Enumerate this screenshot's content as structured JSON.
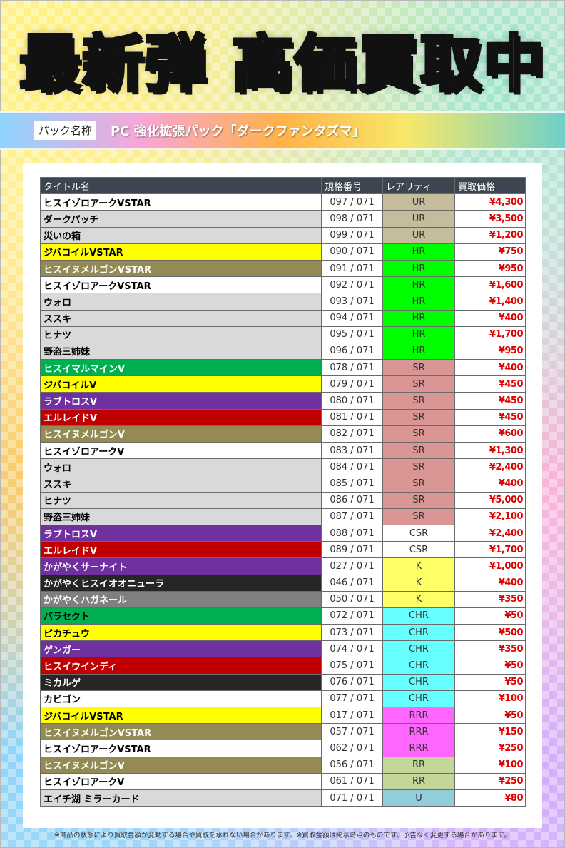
{
  "header": {
    "headline_left": "最新弾",
    "headline_right": "高価買取中"
  },
  "pack": {
    "label": "パック名称",
    "name": "PC 強化拡張パック「ダークファンタズマ」"
  },
  "table": {
    "columns": [
      "タイトル名",
      "規格番号",
      "レアリティ",
      "買取価格"
    ],
    "rows": [
      {
        "title": "ヒスイゾロアークVSTAR",
        "num": "097 / 071",
        "rarity": "UR",
        "price": "¥4,300",
        "bg": "#ffffff",
        "fg": "#000000",
        "rbg": "#c4bc9a"
      },
      {
        "title": "ダークパッチ",
        "num": "098 / 071",
        "rarity": "UR",
        "price": "¥3,500",
        "bg": "#d9d9d9",
        "fg": "#000000",
        "rbg": "#c4bc9a"
      },
      {
        "title": "災いの箱",
        "num": "099 / 071",
        "rarity": "UR",
        "price": "¥1,200",
        "bg": "#d9d9d9",
        "fg": "#000000",
        "rbg": "#c4bc9a"
      },
      {
        "title": "ジバコイルVSTAR",
        "num": "090 / 071",
        "rarity": "HR",
        "price": "¥750",
        "bg": "#ffff00",
        "fg": "#000000",
        "rbg": "#00ff00"
      },
      {
        "title": "ヒスイヌメルゴンVSTAR",
        "num": "091 / 071",
        "rarity": "HR",
        "price": "¥950",
        "bg": "#948a54",
        "fg": "#ffffff",
        "rbg": "#00ff00"
      },
      {
        "title": "ヒスイゾロアークVSTAR",
        "num": "092 / 071",
        "rarity": "HR",
        "price": "¥1,600",
        "bg": "#ffffff",
        "fg": "#000000",
        "rbg": "#00ff00"
      },
      {
        "title": "ウォロ",
        "num": "093 / 071",
        "rarity": "HR",
        "price": "¥1,400",
        "bg": "#d9d9d9",
        "fg": "#000000",
        "rbg": "#00ff00"
      },
      {
        "title": "ススキ",
        "num": "094 / 071",
        "rarity": "HR",
        "price": "¥400",
        "bg": "#d9d9d9",
        "fg": "#000000",
        "rbg": "#00ff00"
      },
      {
        "title": "ヒナツ",
        "num": "095 / 071",
        "rarity": "HR",
        "price": "¥1,700",
        "bg": "#d9d9d9",
        "fg": "#000000",
        "rbg": "#00ff00"
      },
      {
        "title": "野盗三姉妹",
        "num": "096 / 071",
        "rarity": "HR",
        "price": "¥950",
        "bg": "#d9d9d9",
        "fg": "#000000",
        "rbg": "#00ff00"
      },
      {
        "title": "ヒスイマルマインV",
        "num": "078 / 071",
        "rarity": "SR",
        "price": "¥400",
        "bg": "#00b050",
        "fg": "#ffffff",
        "rbg": "#d99694"
      },
      {
        "title": "ジバコイルV",
        "num": "079 / 071",
        "rarity": "SR",
        "price": "¥450",
        "bg": "#ffff00",
        "fg": "#000000",
        "rbg": "#d99694"
      },
      {
        "title": "ラブトロスV",
        "num": "080 / 071",
        "rarity": "SR",
        "price": "¥450",
        "bg": "#7030a0",
        "fg": "#ffffff",
        "rbg": "#d99694"
      },
      {
        "title": "エルレイドV",
        "num": "081 / 071",
        "rarity": "SR",
        "price": "¥450",
        "bg": "#c00000",
        "fg": "#ffffff",
        "rbg": "#d99694"
      },
      {
        "title": "ヒスイヌメルゴンV",
        "num": "082 / 071",
        "rarity": "SR",
        "price": "¥600",
        "bg": "#948a54",
        "fg": "#ffffff",
        "rbg": "#d99694"
      },
      {
        "title": "ヒスイゾロアークV",
        "num": "083 / 071",
        "rarity": "SR",
        "price": "¥1,300",
        "bg": "#ffffff",
        "fg": "#000000",
        "rbg": "#d99694"
      },
      {
        "title": "ウォロ",
        "num": "084 / 071",
        "rarity": "SR",
        "price": "¥2,400",
        "bg": "#d9d9d9",
        "fg": "#000000",
        "rbg": "#d99694"
      },
      {
        "title": "ススキ",
        "num": "085 / 071",
        "rarity": "SR",
        "price": "¥400",
        "bg": "#d9d9d9",
        "fg": "#000000",
        "rbg": "#d99694"
      },
      {
        "title": "ヒナツ",
        "num": "086 / 071",
        "rarity": "SR",
        "price": "¥5,000",
        "bg": "#d9d9d9",
        "fg": "#000000",
        "rbg": "#d99694"
      },
      {
        "title": "野盗三姉妹",
        "num": "087 / 071",
        "rarity": "SR",
        "price": "¥2,100",
        "bg": "#d9d9d9",
        "fg": "#000000",
        "rbg": "#d99694"
      },
      {
        "title": "ラブトロスV",
        "num": "088 / 071",
        "rarity": "CSR",
        "price": "¥2,400",
        "bg": "#7030a0",
        "fg": "#ffffff",
        "rbg": "#ffffff"
      },
      {
        "title": "エルレイドV",
        "num": "089 / 071",
        "rarity": "CSR",
        "price": "¥1,700",
        "bg": "#c00000",
        "fg": "#ffffff",
        "rbg": "#ffffff"
      },
      {
        "title": "かがやくサーナイト",
        "num": "027 / 071",
        "rarity": "K",
        "price": "¥1,000",
        "bg": "#7030a0",
        "fg": "#ffffff",
        "rbg": "#ffff66"
      },
      {
        "title": "かがやくヒスイオオニューラ",
        "num": "046 / 071",
        "rarity": "K",
        "price": "¥400",
        "bg": "#262626",
        "fg": "#ffffff",
        "rbg": "#ffff66"
      },
      {
        "title": "かがやくハガネール",
        "num": "050 / 071",
        "rarity": "K",
        "price": "¥350",
        "bg": "#808080",
        "fg": "#ffffff",
        "rbg": "#ffff66"
      },
      {
        "title": "バラセクト",
        "num": "072 / 071",
        "rarity": "CHR",
        "price": "¥50",
        "bg": "#00b050",
        "fg": "#000000",
        "rbg": "#66ffff"
      },
      {
        "title": "ピカチュウ",
        "num": "073 / 071",
        "rarity": "CHR",
        "price": "¥500",
        "bg": "#ffff00",
        "fg": "#000000",
        "rbg": "#66ffff"
      },
      {
        "title": "ゲンガー",
        "num": "074 / 071",
        "rarity": "CHR",
        "price": "¥350",
        "bg": "#7030a0",
        "fg": "#ffffff",
        "rbg": "#66ffff"
      },
      {
        "title": "ヒスイウインディ",
        "num": "075 / 071",
        "rarity": "CHR",
        "price": "¥50",
        "bg": "#c00000",
        "fg": "#ffffff",
        "rbg": "#66ffff"
      },
      {
        "title": "ミカルゲ",
        "num": "076 / 071",
        "rarity": "CHR",
        "price": "¥50",
        "bg": "#262626",
        "fg": "#ffffff",
        "rbg": "#66ffff"
      },
      {
        "title": "カビゴン",
        "num": "077 / 071",
        "rarity": "CHR",
        "price": "¥100",
        "bg": "#ffffff",
        "fg": "#000000",
        "rbg": "#66ffff"
      },
      {
        "title": "ジバコイルVSTAR",
        "num": "017 / 071",
        "rarity": "RRR",
        "price": "¥50",
        "bg": "#ffff00",
        "fg": "#000000",
        "rbg": "#ff66ff"
      },
      {
        "title": "ヒスイヌメルゴンVSTAR",
        "num": "057 / 071",
        "rarity": "RRR",
        "price": "¥150",
        "bg": "#948a54",
        "fg": "#ffffff",
        "rbg": "#ff66ff"
      },
      {
        "title": "ヒスイゾロアークVSTAR",
        "num": "062 / 071",
        "rarity": "RRR",
        "price": "¥250",
        "bg": "#ffffff",
        "fg": "#000000",
        "rbg": "#ff66ff"
      },
      {
        "title": "ヒスイヌメルゴンV",
        "num": "056 / 071",
        "rarity": "RR",
        "price": "¥100",
        "bg": "#948a54",
        "fg": "#ffffff",
        "rbg": "#c4d79b"
      },
      {
        "title": "ヒスイゾロアークV",
        "num": "061 / 071",
        "rarity": "RR",
        "price": "¥250",
        "bg": "#ffffff",
        "fg": "#000000",
        "rbg": "#c4d79b"
      },
      {
        "title": "エイチ湖 ミラーカード",
        "num": "071 / 071",
        "rarity": "U",
        "price": "¥80",
        "bg": "#d9d9d9",
        "fg": "#000000",
        "rbg": "#92cddc"
      }
    ]
  },
  "footnote": "※商品の状態により買取金額が変動する場合や買取を承れない場合があります。※買取金額は掲示時点のものです。予告なく変更する場合があります。"
}
